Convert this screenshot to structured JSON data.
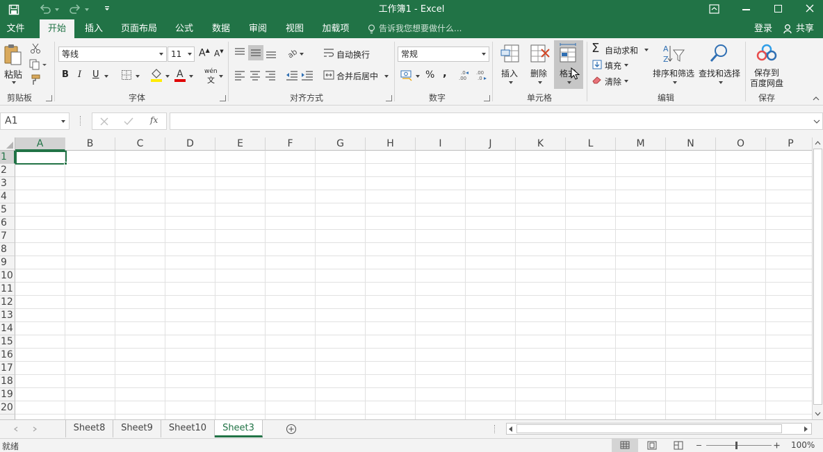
{
  "titlebar": {
    "title": "工作簿1 - Excel",
    "qat": [
      "save-icon",
      "undo-icon",
      "redo-icon",
      "customize-qat-icon"
    ],
    "window_controls": [
      "ribbon-display-icon",
      "minimize-icon",
      "maximize-icon",
      "close-icon"
    ]
  },
  "tabs": {
    "file": "文件",
    "home": "开始",
    "insert": "插入",
    "layout": "页面布局",
    "formulas": "公式",
    "data": "数据",
    "review": "审阅",
    "view": "视图",
    "addins": "加载项",
    "tellme": "告诉我您想要做什么...",
    "login": "登录",
    "share": "共享"
  },
  "ribbon": {
    "clipboard": {
      "paste": "粘贴",
      "label": "剪贴板"
    },
    "font": {
      "name": "等线",
      "size": "11",
      "label": "字体",
      "bold": "B",
      "italic": "I",
      "underline": "U",
      "phonetic": "wén"
    },
    "alignment": {
      "wrap": "自动换行",
      "merge": "合并后居中",
      "label": "对齐方式"
    },
    "number": {
      "format": "常规",
      "percent": "%",
      "comma": ",",
      "label": "数字"
    },
    "cells": {
      "insert": "插入",
      "delete": "删除",
      "format": "格式",
      "label": "单元格"
    },
    "editing": {
      "autosum": "自动求和",
      "fill": "填充",
      "clear": "清除",
      "sort": "排序和筛选",
      "find": "查找和选择",
      "label": "编辑"
    },
    "save": {
      "button": "保存到\n百度网盘",
      "line1": "保存到",
      "line2": "百度网盘",
      "label": "保存"
    }
  },
  "formulabar": {
    "namebox": "A1",
    "fx": "fx",
    "content": ""
  },
  "grid": {
    "columns": [
      "A",
      "B",
      "C",
      "D",
      "E",
      "F",
      "G",
      "H",
      "I",
      "J",
      "K",
      "L",
      "M",
      "N",
      "O",
      "P"
    ],
    "rows": [
      "1",
      "2",
      "3",
      "4",
      "5",
      "6",
      "7",
      "8",
      "9",
      "10",
      "11",
      "12",
      "13",
      "14",
      "15",
      "16",
      "17",
      "18",
      "19",
      "20"
    ],
    "active_cell": "A1"
  },
  "sheets": {
    "tabs": [
      "Sheet8",
      "Sheet9",
      "Sheet10",
      "Sheet3"
    ],
    "active": "Sheet3"
  },
  "status": {
    "ready": "就绪",
    "zoom": "100%"
  },
  "colors": {
    "excel_green": "#217346",
    "ribbon_bg": "#f3f3f3",
    "gridline": "#e1e1e1"
  }
}
